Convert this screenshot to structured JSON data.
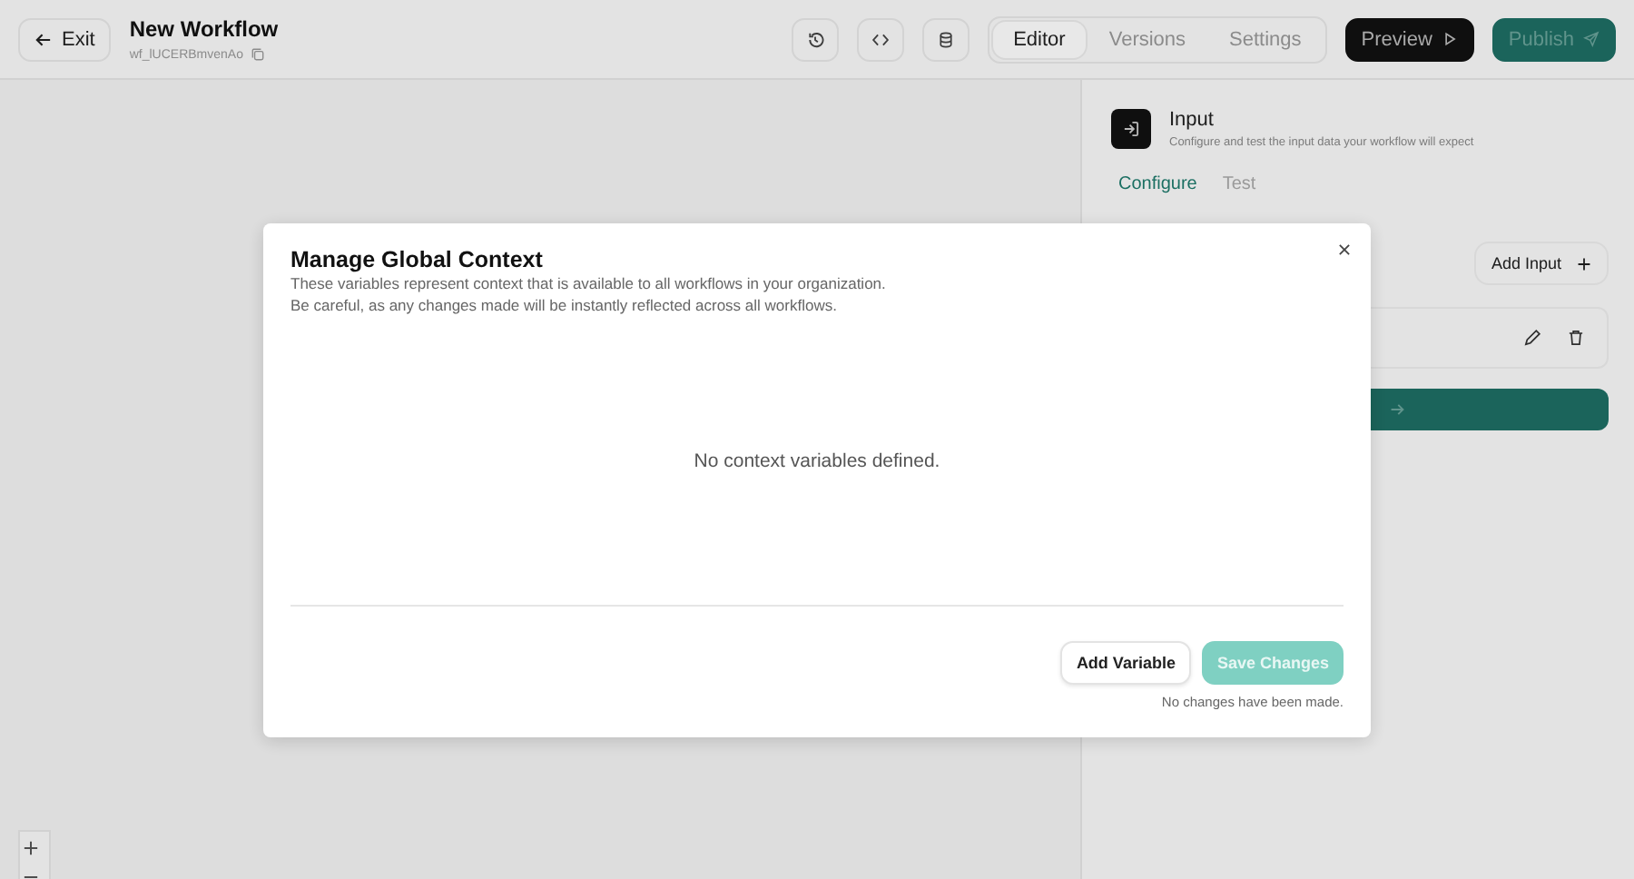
{
  "header": {
    "exit_label": "Exit",
    "title": "New Workflow",
    "workflow_id": "wf_lUCERBmvenAo",
    "view_tabs": [
      {
        "label": "Editor",
        "selected": true
      },
      {
        "label": "Versions",
        "selected": false
      },
      {
        "label": "Settings",
        "selected": false
      }
    ],
    "preview_label": "Preview",
    "publish_label": "Publish"
  },
  "panel": {
    "title": "Input",
    "description": "Configure and test the input data your workflow will expect",
    "tabs": [
      {
        "label": "Configure",
        "selected": true
      },
      {
        "label": "Test",
        "selected": false
      }
    ],
    "add_input_label": "Add Input"
  },
  "modal": {
    "title": "Manage Global Context",
    "description": [
      "These variables represent context that is available to all workflows in your organization.",
      "Be careful, as any changes made will be instantly reflected across all workflows."
    ],
    "empty_message": "No context variables defined.",
    "add_variable_label": "Add Variable",
    "save_button": {
      "label": "Save Changes",
      "disabled": true
    },
    "status": "No changes have been made."
  }
}
